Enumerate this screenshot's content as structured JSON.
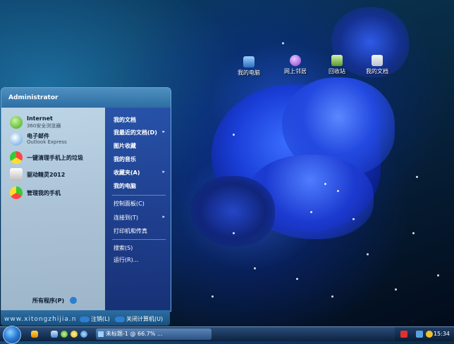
{
  "desktop": {
    "icons": [
      {
        "label": "我的电脑"
      },
      {
        "label": "网上邻居"
      },
      {
        "label": "回收站"
      },
      {
        "label": "我的文档"
      }
    ]
  },
  "start_menu": {
    "user": "Administrator",
    "pinned": [
      {
        "title": "Internet",
        "subtitle": "360安全浏览器"
      },
      {
        "title": "电子邮件",
        "subtitle": "Outlook Express"
      }
    ],
    "recent": [
      {
        "title": "一键清理手机上的垃圾"
      },
      {
        "title": "驱动精灵2012"
      },
      {
        "title": "管理我的手机"
      }
    ],
    "all_programs": "所有程序(P)",
    "right_items": [
      {
        "label": "我的文档"
      },
      {
        "label": "我最近的文档(D)"
      },
      {
        "label": "图片收藏"
      },
      {
        "label": "我的音乐"
      },
      {
        "label": "收藏夹(A)"
      },
      {
        "label": "我的电脑"
      },
      {
        "label": "控制面板(C)"
      },
      {
        "label": "连接到(T)"
      },
      {
        "label": "打印机和传真"
      },
      {
        "label": "搜索(S)"
      },
      {
        "label": "运行(R)..."
      }
    ],
    "logoff": "注销(L)",
    "shutdown": "关闭计算机(U)"
  },
  "watermark": "www.xitongzhijia.n",
  "taskbar": {
    "task_label": "未标题-1 @ 66.7% ...",
    "clock": "15:34"
  }
}
